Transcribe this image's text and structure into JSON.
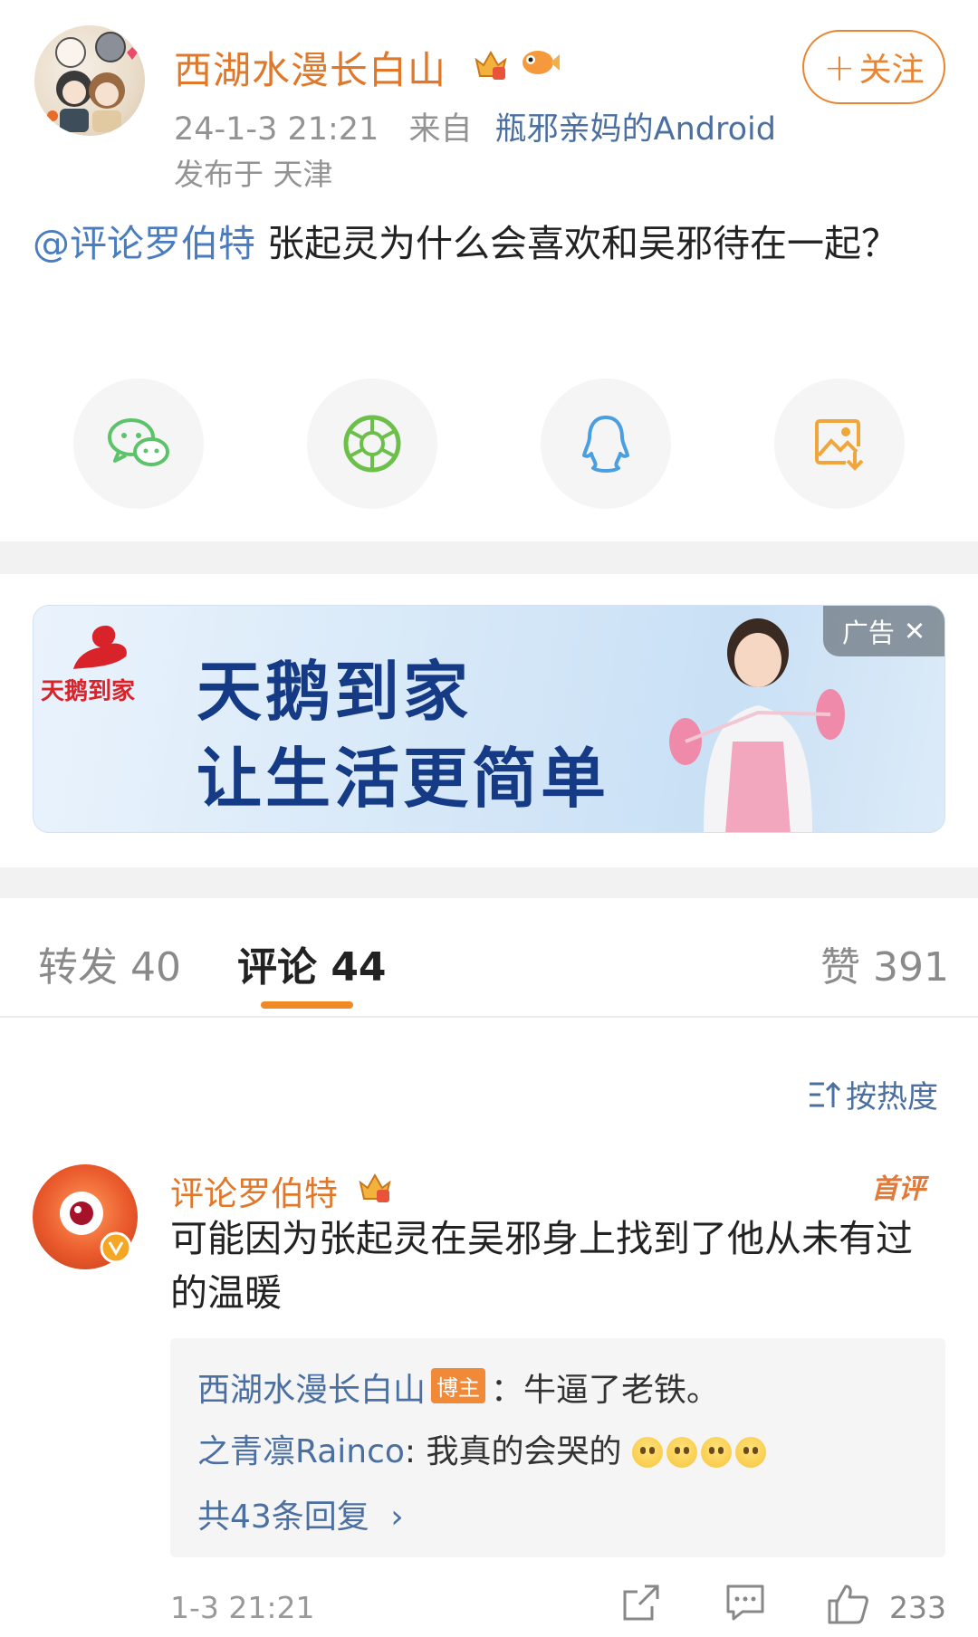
{
  "post": {
    "username": "西湖水漫长白山",
    "timestamp": "24-1-3 21:21",
    "source_prefix": "来自",
    "source": "瓶邪亲妈的Android",
    "location": "发布于 天津",
    "follow_label": "关注",
    "mention": "@评论罗伯特",
    "text": " 张起灵为什么会喜欢和吴邪待在一起？"
  },
  "share": {
    "items": [
      "wechat-icon",
      "moments-icon",
      "qq-icon",
      "save-image-icon"
    ],
    "colors": {
      "wechat": "#5cc36a",
      "moments": "#6cc04a",
      "qq": "#4a9fe0",
      "save": "#f0a63a"
    }
  },
  "ad": {
    "brand": "天鹅到家",
    "line1": "天鹅到家",
    "line2": "让生活更简单",
    "tag": "广告"
  },
  "tabs": {
    "repost": "转发 40",
    "comment": "评论 44",
    "like": "赞 391"
  },
  "sort_label": "按热度",
  "comment": {
    "username": "评论罗伯特",
    "first_tag": "首评",
    "text": "可能因为张起灵在吴邪身上找到了他从未有过的温暖",
    "replies": [
      {
        "user": "西湖水漫长白山",
        "badge": "博主",
        "text": "：牛逼了老铁。"
      },
      {
        "user": "之青凛Rainco",
        "text": ": 我真的会哭的"
      }
    ],
    "more_replies": "共43条回复",
    "time": "1-3 21:21",
    "likes": "233"
  },
  "colors": {
    "accent": "#ef8a27",
    "username": "#e0782b",
    "link": "#4a6fa0"
  }
}
